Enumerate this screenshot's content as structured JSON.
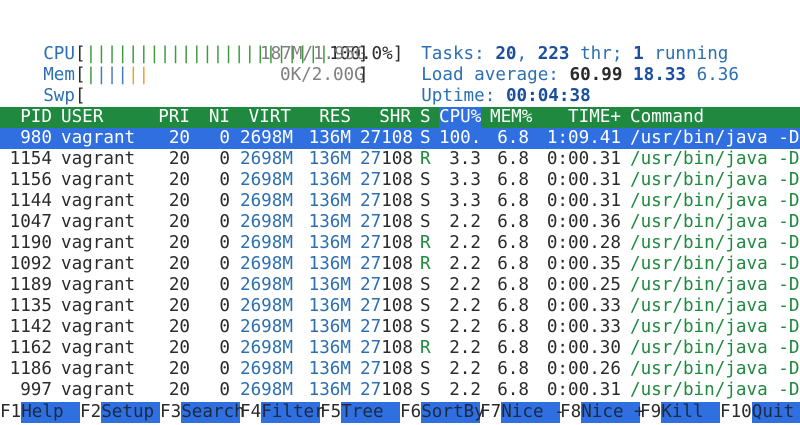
{
  "meters": {
    "cpu": {
      "label": "CPU",
      "open": "[",
      "bar": "|||||||||||||||||||||||",
      "value": "100.0%",
      "close": "]",
      "bar_color": "#3f9a3f",
      "fill_fraction": 1.0
    },
    "mem": {
      "label": "Mem",
      "open": "[",
      "bar_green": "|",
      "bar_blue": "|||",
      "bar_orange": "||",
      "value": "187M/1.95G",
      "close": "]",
      "used_fraction": 0.094
    },
    "swp": {
      "label": "Swp",
      "open": "[",
      "value": "0K/2.00G",
      "close": "]",
      "used_fraction": 0.0
    }
  },
  "stats": {
    "tasks_label": "Tasks: ",
    "tasks": "20",
    "thr_sep": ", ",
    "threads": "223",
    "thr_label": " thr; ",
    "running": "1",
    "running_label": " running",
    "load_label": "Load average: ",
    "load1": "60.99",
    "load5": "18.33",
    "load15": "6.36",
    "uptime_label": "Uptime: ",
    "uptime": "00:04:38"
  },
  "table": {
    "headers": {
      "pid": "PID",
      "user": "USER",
      "pri": "PRI",
      "ni": "NI",
      "virt": "VIRT",
      "res": "RES",
      "shr": "SHR",
      "s": "S",
      "cpu": "CPU%",
      "mem": "MEM%",
      "time": "TIME+",
      "command": "Command"
    },
    "rows": [
      {
        "pid": "980",
        "user": "vagrant",
        "pri": "20",
        "ni": "0",
        "virt": "2698M",
        "res": "136M",
        "shr_a": "27",
        "shr_b": "108",
        "s": "S",
        "cpu": "100.",
        "mem": "6.8",
        "time": "1:09.41",
        "command": "/usr/bin/java -Dj"
      },
      {
        "pid": "1154",
        "user": "vagrant",
        "pri": "20",
        "ni": "0",
        "virt": "2698M",
        "res": "136M",
        "shr_a": "27",
        "shr_b": "108",
        "s": "R",
        "cpu": "3.3",
        "mem": "6.8",
        "time": "0:00.31",
        "command": "/usr/bin/java -Dj"
      },
      {
        "pid": "1156",
        "user": "vagrant",
        "pri": "20",
        "ni": "0",
        "virt": "2698M",
        "res": "136M",
        "shr_a": "27",
        "shr_b": "108",
        "s": "S",
        "cpu": "3.3",
        "mem": "6.8",
        "time": "0:00.31",
        "command": "/usr/bin/java -Dj"
      },
      {
        "pid": "1144",
        "user": "vagrant",
        "pri": "20",
        "ni": "0",
        "virt": "2698M",
        "res": "136M",
        "shr_a": "27",
        "shr_b": "108",
        "s": "S",
        "cpu": "3.3",
        "mem": "6.8",
        "time": "0:00.31",
        "command": "/usr/bin/java -Dj"
      },
      {
        "pid": "1047",
        "user": "vagrant",
        "pri": "20",
        "ni": "0",
        "virt": "2698M",
        "res": "136M",
        "shr_a": "27",
        "shr_b": "108",
        "s": "S",
        "cpu": "2.2",
        "mem": "6.8",
        "time": "0:00.36",
        "command": "/usr/bin/java -Dj"
      },
      {
        "pid": "1190",
        "user": "vagrant",
        "pri": "20",
        "ni": "0",
        "virt": "2698M",
        "res": "136M",
        "shr_a": "27",
        "shr_b": "108",
        "s": "R",
        "cpu": "2.2",
        "mem": "6.8",
        "time": "0:00.28",
        "command": "/usr/bin/java -Dj"
      },
      {
        "pid": "1092",
        "user": "vagrant",
        "pri": "20",
        "ni": "0",
        "virt": "2698M",
        "res": "136M",
        "shr_a": "27",
        "shr_b": "108",
        "s": "R",
        "cpu": "2.2",
        "mem": "6.8",
        "time": "0:00.35",
        "command": "/usr/bin/java -Dj"
      },
      {
        "pid": "1189",
        "user": "vagrant",
        "pri": "20",
        "ni": "0",
        "virt": "2698M",
        "res": "136M",
        "shr_a": "27",
        "shr_b": "108",
        "s": "S",
        "cpu": "2.2",
        "mem": "6.8",
        "time": "0:00.25",
        "command": "/usr/bin/java -Dj"
      },
      {
        "pid": "1135",
        "user": "vagrant",
        "pri": "20",
        "ni": "0",
        "virt": "2698M",
        "res": "136M",
        "shr_a": "27",
        "shr_b": "108",
        "s": "S",
        "cpu": "2.2",
        "mem": "6.8",
        "time": "0:00.33",
        "command": "/usr/bin/java -Dj"
      },
      {
        "pid": "1142",
        "user": "vagrant",
        "pri": "20",
        "ni": "0",
        "virt": "2698M",
        "res": "136M",
        "shr_a": "27",
        "shr_b": "108",
        "s": "S",
        "cpu": "2.2",
        "mem": "6.8",
        "time": "0:00.33",
        "command": "/usr/bin/java -Dj"
      },
      {
        "pid": "1162",
        "user": "vagrant",
        "pri": "20",
        "ni": "0",
        "virt": "2698M",
        "res": "136M",
        "shr_a": "27",
        "shr_b": "108",
        "s": "R",
        "cpu": "2.2",
        "mem": "6.8",
        "time": "0:00.30",
        "command": "/usr/bin/java -Dj"
      },
      {
        "pid": "1186",
        "user": "vagrant",
        "pri": "20",
        "ni": "0",
        "virt": "2698M",
        "res": "136M",
        "shr_a": "27",
        "shr_b": "108",
        "s": "S",
        "cpu": "2.2",
        "mem": "6.8",
        "time": "0:00.26",
        "command": "/usr/bin/java -Dj"
      },
      {
        "pid": "997",
        "user": "vagrant",
        "pri": "20",
        "ni": "0",
        "virt": "2698M",
        "res": "136M",
        "shr_a": "27",
        "shr_b": "108",
        "s": "S",
        "cpu": "2.2",
        "mem": "6.8",
        "time": "0:00.31",
        "command": "/usr/bin/java -Dj"
      }
    ]
  },
  "footer": [
    {
      "key": "F1",
      "label": "Help"
    },
    {
      "key": "F2",
      "label": "Setup"
    },
    {
      "key": "F3",
      "label": "Search"
    },
    {
      "key": "F4",
      "label": "Filter"
    },
    {
      "key": "F5",
      "label": "Tree"
    },
    {
      "key": "F6",
      "label": "SortBy"
    },
    {
      "key": "F7",
      "label": "Nice -"
    },
    {
      "key": "F8",
      "label": "Nice +"
    },
    {
      "key": "F9",
      "label": "Kill"
    },
    {
      "key": "F10",
      "label": "Quit"
    }
  ],
  "colors": {
    "header_bg": "#1f8a3f",
    "selected_bg": "#2f6fe0",
    "accent_blue": "#2c6fb3",
    "accent_green": "#1f8a3f"
  }
}
